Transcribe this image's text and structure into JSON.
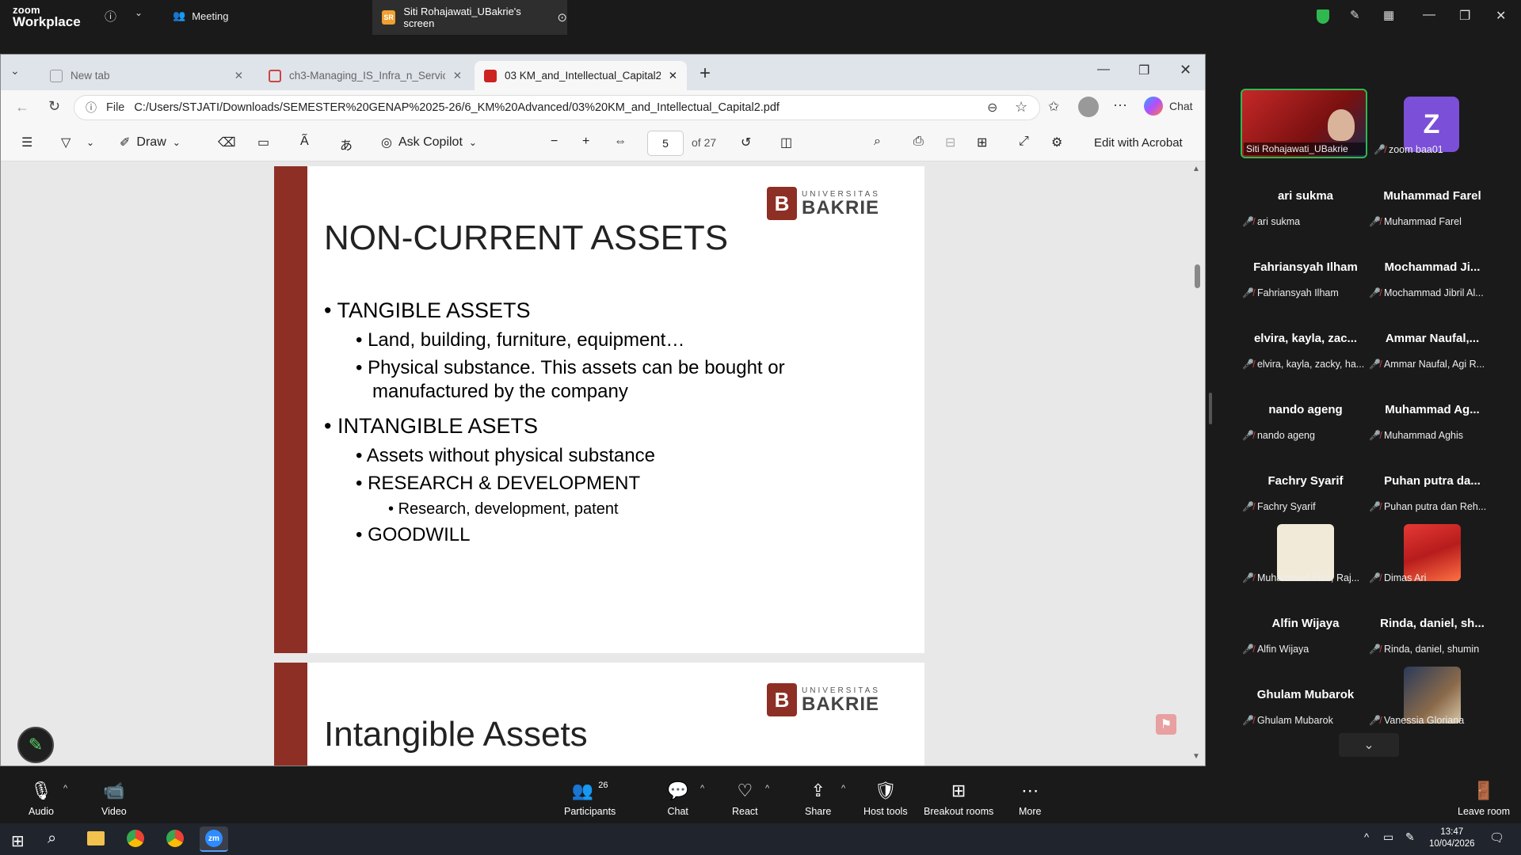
{
  "zoom": {
    "brand_top": "zoom",
    "brand_bottom": "Workplace",
    "meeting_tab": "Meeting",
    "share_tab_badge": "SR",
    "share_tab": "Siti Rohajawati_UBakrie's screen"
  },
  "browser": {
    "tabs": [
      {
        "label": "New tab"
      },
      {
        "label": "ch3-Managing_IS_Infra_n_Services"
      },
      {
        "label": "03 KM_and_Intellectual_Capital2.pdf"
      }
    ],
    "url_scheme": "File",
    "url": "C:/Users/STJATI/Downloads/SEMESTER%20GENAP%2025-26/6_KM%20Advanced/03%20KM_and_Intellectual_Capital2.pdf",
    "chat_label": "Chat"
  },
  "pdf_toolbar": {
    "draw": "Draw",
    "ask_copilot": "Ask Copilot",
    "page_current": "5",
    "page_total": "of 27",
    "edit_acrobat": "Edit with Acrobat"
  },
  "slide1": {
    "logo_top": "UNIVERSITAS",
    "logo_bottom": "BAKRIE",
    "title": "NON-CURRENT ASSETS",
    "lines": [
      "TANGIBLE ASSETS",
      "Land, building, furniture, equipment…",
      "Physical substance. This assets can be bought  or",
      "manufactured by the company",
      "INTANGIBLE ASETS",
      "Assets without physical substance",
      "RESEARCH & DEVELOPMENT",
      "Research, development, patent",
      "GOODWILL"
    ]
  },
  "slide2": {
    "logo_top": "UNIVERSITAS",
    "logo_bottom": "BAKRIE",
    "title": "Intangible Assets"
  },
  "participants": {
    "video_tiles": [
      {
        "label": "Siti Rohajawati_UBakrie"
      },
      {
        "letter": "Z",
        "label": "zoom baa01"
      }
    ],
    "list": [
      {
        "name": "ari sukma",
        "label": "ari sukma"
      },
      {
        "name": "Muhammad Farel",
        "label": "Muhammad Farel"
      },
      {
        "name": "Fahriansyah Ilham",
        "label": "Fahriansyah Ilham"
      },
      {
        "name": "Mochammad Ji...",
        "label": "Mochammad Jibril Al..."
      },
      {
        "name": "elvira, kayla, zac...",
        "label": "elvira, kayla, zacky, ha..."
      },
      {
        "name": "Ammar Naufal,...",
        "label": "Ammar Naufal, Agi R..."
      },
      {
        "name": "nando ageng",
        "label": "nando ageng"
      },
      {
        "name": "Muhammad Ag...",
        "label": "Muhammad Aghis"
      },
      {
        "name": "Fachry Syarif",
        "label": "Fachry Syarif"
      },
      {
        "name": "Puhan putra da...",
        "label": "Puhan putra dan Reh..."
      },
      {
        "name": "",
        "label": "Muhammad Faiz, Raj..."
      },
      {
        "name": "",
        "label": "Dimas Ari"
      },
      {
        "name": "Alfin Wijaya",
        "label": "Alfin Wijaya"
      },
      {
        "name": "Rinda, daniel, sh...",
        "label": "Rinda, daniel, shumin"
      },
      {
        "name": "Ghulam Mubarok",
        "label": "Ghulam Mubarok"
      },
      {
        "name": "",
        "label": "Vanessia Gloriana"
      }
    ]
  },
  "bottom_bar": {
    "audio": "Audio",
    "video": "Video",
    "participants": "Participants",
    "participants_count": "26",
    "chat": "Chat",
    "react": "React",
    "share": "Share",
    "host_tools": "Host tools",
    "breakout": "Breakout rooms",
    "more": "More",
    "leave": "Leave room"
  },
  "taskbar": {
    "time": "13:47",
    "date": "10/04/2026",
    "zm": "zm"
  },
  "colors": {
    "slide_band": "#8e2f25",
    "zoom_bg": "#1a1a1a",
    "mute_red": "#e04343"
  }
}
